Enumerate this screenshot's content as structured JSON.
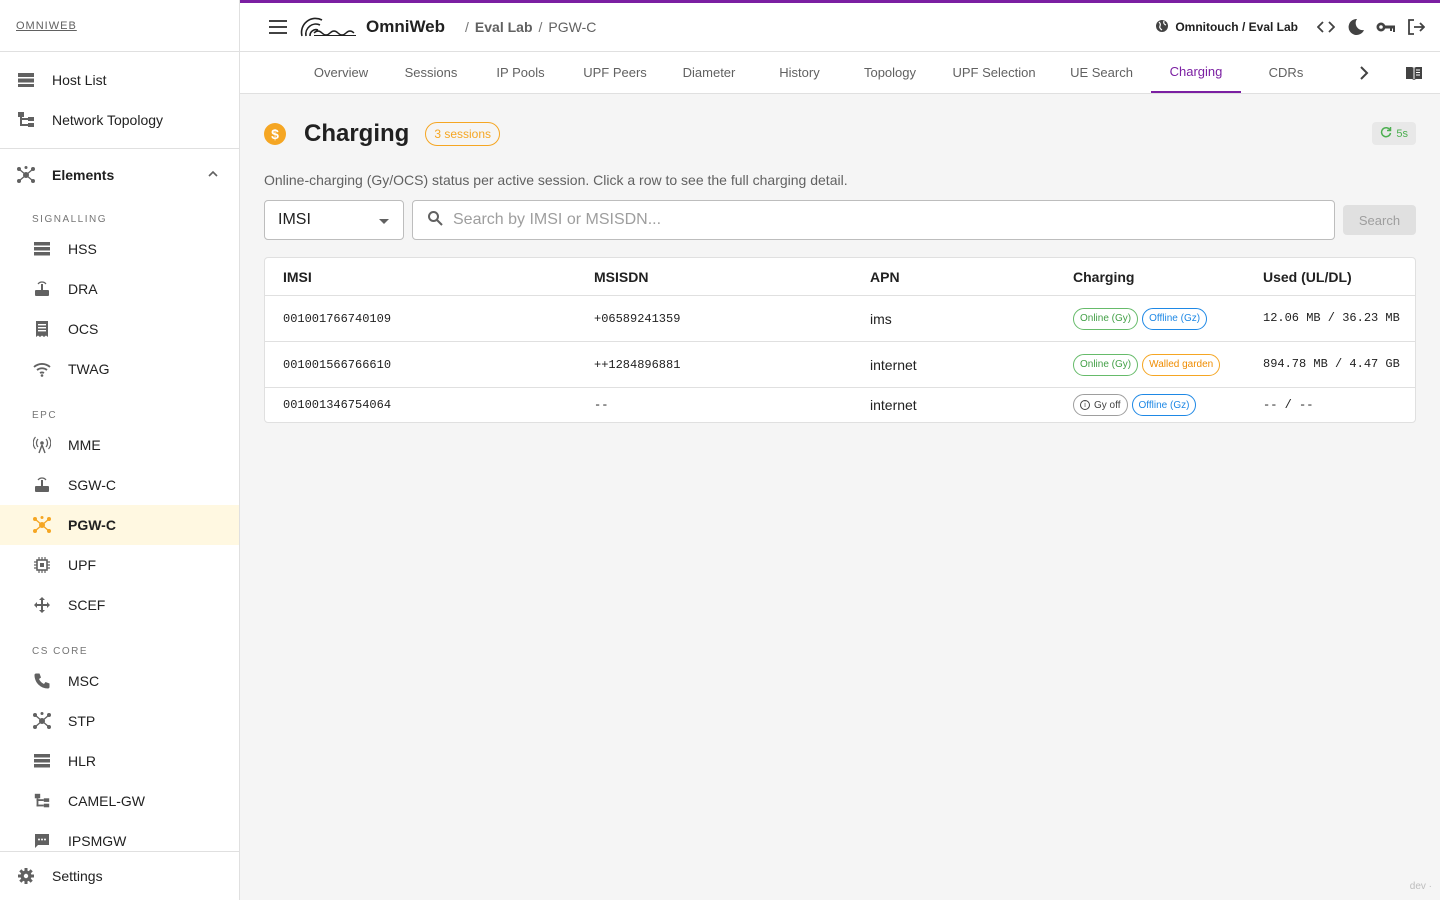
{
  "brand": "OMNIWEB",
  "sidebar": {
    "top_items": [
      {
        "label": "Host List",
        "icon": "host-list-icon"
      },
      {
        "label": "Network Topology",
        "icon": "topology-icon"
      }
    ],
    "elements_label": "Elements",
    "sections": [
      {
        "title": "SIGNALLING",
        "items": [
          {
            "label": "HSS",
            "icon": "storage-icon"
          },
          {
            "label": "DRA",
            "icon": "router-icon"
          },
          {
            "label": "OCS",
            "icon": "receipt-icon"
          },
          {
            "label": "TWAG",
            "icon": "wifi-icon"
          }
        ]
      },
      {
        "title": "EPC",
        "items": [
          {
            "label": "MME",
            "icon": "antenna-icon"
          },
          {
            "label": "SGW-C",
            "icon": "router-icon"
          },
          {
            "label": "PGW-C",
            "icon": "hub-icon",
            "active": true
          },
          {
            "label": "UPF",
            "icon": "chip-icon"
          },
          {
            "label": "SCEF",
            "icon": "arrows-icon"
          }
        ]
      },
      {
        "title": "CS CORE",
        "items": [
          {
            "label": "MSC",
            "icon": "phone-icon"
          },
          {
            "label": "STP",
            "icon": "hub-icon"
          },
          {
            "label": "HLR",
            "icon": "storage-icon"
          },
          {
            "label": "CAMEL-GW",
            "icon": "topology-icon"
          },
          {
            "label": "IPSMGW",
            "icon": "sms-icon"
          }
        ]
      }
    ],
    "settings_label": "Settings"
  },
  "header": {
    "app_name": "OmniWeb",
    "breadcrumb": [
      "Eval Lab",
      "PGW-C"
    ],
    "tenant": "Omnitouch / Eval Lab"
  },
  "tabs": [
    "Overview",
    "Sessions",
    "IP Pools",
    "UPF Peers",
    "Diameter",
    "History",
    "Topology",
    "UPF Selection",
    "UE Search",
    "Charging",
    "CDRs"
  ],
  "active_tab": "Charging",
  "page": {
    "title": "Charging",
    "badge": "3 sessions",
    "refresh": "5s",
    "subtitle": "Online-charging (Gy/OCS) status per active session. Click a row to see the full charging detail."
  },
  "search": {
    "field": "IMSI",
    "placeholder": "Search by IMSI or MSISDN...",
    "button": "Search"
  },
  "table": {
    "columns": [
      "IMSI",
      "MSISDN",
      "APN",
      "Charging",
      "Used (UL/DL)"
    ],
    "rows": [
      {
        "imsi": "001001766740109",
        "msisdn": "+06589241359",
        "apn": "ims",
        "chips": [
          {
            "label": "Online (Gy)",
            "color": "green"
          },
          {
            "label": "Offline (Gz)",
            "color": "blue"
          }
        ],
        "used": "12.06 MB / 36.23 MB"
      },
      {
        "imsi": "001001566766610",
        "msisdn": "++1284896881",
        "apn": "internet",
        "chips": [
          {
            "label": "Online (Gy)",
            "color": "green"
          },
          {
            "label": "Walled garden",
            "color": "orange"
          }
        ],
        "used": "894.78 MB / 4.47 GB"
      },
      {
        "imsi": "001001346754064",
        "msisdn": "--",
        "apn": "internet",
        "chips": [
          {
            "label": "Gy off",
            "color": "grey",
            "info": true
          },
          {
            "label": "Offline (Gz)",
            "color": "blue"
          }
        ],
        "used": "-- / --"
      }
    ]
  },
  "footer": "dev ·"
}
